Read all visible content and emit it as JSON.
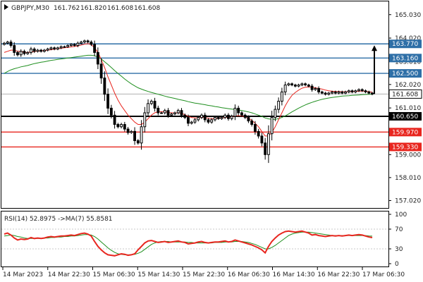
{
  "header": {
    "symbol": "GBPJPY,M30",
    "open": "161.762",
    "high": "161.820",
    "low": "161.608",
    "close": "161.608"
  },
  "rsi_header": {
    "label": "RSI(14) 52.8975",
    "ma_label": "->MA(7) 55.8581"
  },
  "colors": {
    "candle": "#000000",
    "ma_fast": "#e8261f",
    "ma_slow": "#1f8f1f",
    "level_blue": "#2e6fa7",
    "level_black": "#000000",
    "level_red": "#e8261f",
    "rsi_line": "#e8261f",
    "rsi_ma": "#1f8f1f",
    "arrow": "#000000",
    "price_tag_bg": "#ffffff"
  },
  "chart_data": {
    "type": "candlestick",
    "timeframe": "M30",
    "y_axis": {
      "ylim": [
        156.7,
        165.6
      ],
      "ticks": [
        "165.030",
        "164.020",
        "163.010",
        "162.020",
        "161.010",
        "160.000",
        "159.000",
        "158.010",
        "157.020"
      ]
    },
    "x_axis": {
      "tick_labels": [
        "14 Mar 2023",
        "14 Mar 22:30",
        "15 Mar 06:30",
        "15 Mar 14:30",
        "15 Mar 22:30",
        "16 Mar 06:30",
        "16 Mar 14:30",
        "16 Mar 22:30",
        "17 Mar 06:30"
      ]
    },
    "price_levels": [
      {
        "value": 163.77,
        "label": "163.770",
        "style": "blue"
      },
      {
        "value": 163.16,
        "label": "163.160",
        "style": "blue"
      },
      {
        "value": 162.5,
        "label": "162.500",
        "style": "blue"
      },
      {
        "value": 160.65,
        "label": "160.650",
        "style": "black"
      },
      {
        "value": 159.97,
        "label": "159.970",
        "style": "red"
      },
      {
        "value": 159.33,
        "label": "159.330",
        "style": "red"
      }
    ],
    "current_price": {
      "value": 161.608,
      "label": "161.608"
    },
    "close_series": [
      163.8,
      163.85,
      163.7,
      163.4,
      163.3,
      163.45,
      163.35,
      163.4,
      163.55,
      163.45,
      163.5,
      163.45,
      163.5,
      163.55,
      163.6,
      163.55,
      163.6,
      163.65,
      163.65,
      163.7,
      163.75,
      163.7,
      163.8,
      163.85,
      163.9,
      163.85,
      163.75,
      163.4,
      162.9,
      162.3,
      161.6,
      161.0,
      160.7,
      160.3,
      160.2,
      160.3,
      160.1,
      159.95,
      160.0,
      159.6,
      159.5,
      160.2,
      160.8,
      161.2,
      161.3,
      161.0,
      160.8,
      160.8,
      160.9,
      160.7,
      160.75,
      160.8,
      160.9,
      160.7,
      160.6,
      160.35,
      160.4,
      160.5,
      160.6,
      160.7,
      160.5,
      160.4,
      160.5,
      160.6,
      160.55,
      160.6,
      160.7,
      160.55,
      160.65,
      161.0,
      160.8,
      160.7,
      160.6,
      160.45,
      160.3,
      160.0,
      159.8,
      159.5,
      159.0,
      159.9,
      160.6,
      160.95,
      161.3,
      161.7,
      162.0,
      162.05,
      162.0,
      161.95,
      162.0,
      162.05,
      162.0,
      161.95,
      161.8,
      161.85,
      161.7,
      161.65,
      161.6,
      161.65,
      161.7,
      161.65,
      161.7,
      161.65,
      161.7,
      161.75,
      161.7,
      161.75,
      161.8,
      161.75,
      161.7,
      161.65,
      161.608
    ],
    "ma_fast": [
      163.4,
      163.45,
      163.5,
      163.5,
      163.45,
      163.45,
      163.4,
      163.4,
      163.42,
      163.44,
      163.46,
      163.47,
      163.48,
      163.5,
      163.52,
      163.54,
      163.56,
      163.58,
      163.6,
      163.62,
      163.64,
      163.66,
      163.68,
      163.72,
      163.76,
      163.78,
      163.74,
      163.6,
      163.4,
      163.1,
      162.75,
      162.35,
      162.0,
      161.65,
      161.35,
      161.1,
      160.9,
      160.7,
      160.55,
      160.4,
      160.3,
      160.3,
      160.4,
      160.55,
      160.7,
      160.8,
      160.85,
      160.85,
      160.85,
      160.82,
      160.8,
      160.8,
      160.8,
      160.78,
      160.72,
      160.65,
      160.6,
      160.58,
      160.58,
      160.6,
      160.6,
      160.57,
      160.55,
      160.56,
      160.57,
      160.58,
      160.6,
      160.61,
      160.62,
      160.66,
      160.68,
      160.66,
      160.62,
      160.56,
      160.48,
      160.35,
      160.2,
      160.0,
      159.8,
      159.8,
      159.95,
      160.2,
      160.5,
      160.8,
      161.1,
      161.35,
      161.55,
      161.68,
      161.78,
      161.86,
      161.9,
      161.92,
      161.9,
      161.88,
      161.85,
      161.82,
      161.78,
      161.75,
      161.73,
      161.72,
      161.72,
      161.71,
      161.71,
      161.71,
      161.71,
      161.72,
      161.73,
      161.74,
      161.73,
      161.71,
      161.69
    ],
    "ma_slow": [
      162.5,
      162.58,
      162.65,
      162.7,
      162.74,
      162.78,
      162.81,
      162.84,
      162.88,
      162.92,
      162.95,
      162.98,
      163.0,
      163.03,
      163.06,
      163.08,
      163.1,
      163.12,
      163.14,
      163.16,
      163.18,
      163.2,
      163.22,
      163.24,
      163.26,
      163.28,
      163.28,
      163.26,
      163.2,
      163.12,
      163.0,
      162.88,
      162.75,
      162.62,
      162.5,
      162.38,
      162.26,
      162.15,
      162.05,
      161.96,
      161.88,
      161.82,
      161.77,
      161.72,
      161.68,
      161.64,
      161.6,
      161.56,
      161.52,
      161.48,
      161.45,
      161.42,
      161.38,
      161.35,
      161.32,
      161.28,
      161.25,
      161.22,
      161.2,
      161.17,
      161.15,
      161.12,
      161.1,
      161.07,
      161.05,
      161.02,
      161.0,
      160.98,
      160.96,
      160.94,
      160.92,
      160.9,
      160.87,
      160.84,
      160.8,
      160.75,
      160.7,
      160.65,
      160.58,
      160.54,
      160.52,
      160.52,
      160.55,
      160.6,
      160.67,
      160.75,
      160.84,
      160.92,
      161.0,
      161.07,
      161.14,
      161.2,
      161.25,
      161.3,
      161.34,
      161.38,
      161.41,
      161.44,
      161.46,
      161.48,
      161.5,
      161.52,
      161.53,
      161.54,
      161.55,
      161.56,
      161.57,
      161.58,
      161.59,
      161.6,
      161.6
    ],
    "rsi": {
      "name": "RSI(14)",
      "value": 52.8975,
      "ma_name": "MA(7)",
      "ma_value": 55.8581,
      "ylim": [
        0,
        100
      ],
      "levels": [
        70,
        30
      ],
      "ticks": [
        "100",
        "70",
        "30",
        "0"
      ],
      "values": [
        60,
        62,
        58,
        52,
        48,
        50,
        49,
        50,
        53,
        51,
        52,
        51,
        52,
        54,
        55,
        54,
        55,
        56,
        56,
        57,
        58,
        57,
        59,
        61,
        62,
        60,
        56,
        45,
        35,
        28,
        22,
        18,
        17,
        16,
        18,
        20,
        19,
        17,
        18,
        20,
        28,
        35,
        42,
        46,
        47,
        45,
        43,
        44,
        45,
        43,
        44,
        45,
        46,
        44,
        43,
        40,
        41,
        42,
        44,
        45,
        43,
        42,
        43,
        44,
        44,
        45,
        46,
        44,
        45,
        48,
        46,
        44,
        42,
        40,
        38,
        35,
        32,
        28,
        22,
        35,
        45,
        52,
        58,
        62,
        65,
        66,
        65,
        64,
        65,
        66,
        64,
        62,
        58,
        59,
        57,
        56,
        55,
        56,
        57,
        56,
        57,
        56,
        57,
        58,
        57,
        58,
        59,
        58,
        56,
        54,
        52.9
      ],
      "ma_values": [
        56,
        57,
        58,
        57,
        55,
        54,
        52,
        51,
        51,
        51,
        51,
        51,
        52,
        52,
        53,
        53,
        54,
        54,
        55,
        55,
        56,
        56,
        57,
        58,
        59,
        59,
        58,
        55,
        50,
        44,
        38,
        32,
        27,
        23,
        20,
        19,
        18,
        18,
        18,
        19,
        21,
        24,
        29,
        34,
        39,
        42,
        44,
        45,
        45,
        45,
        44,
        44,
        44,
        44,
        44,
        43,
        43,
        42,
        42,
        42,
        42,
        42,
        42,
        43,
        43,
        43,
        44,
        44,
        44,
        45,
        45,
        45,
        44,
        43,
        41,
        39,
        36,
        33,
        30,
        30,
        33,
        37,
        42,
        47,
        52,
        57,
        60,
        62,
        63,
        64,
        64,
        64,
        63,
        62,
        61,
        60,
        59,
        58,
        57,
        57,
        57,
        57,
        57,
        57,
        57,
        57,
        57,
        57,
        57,
        56,
        55.9
      ]
    }
  }
}
